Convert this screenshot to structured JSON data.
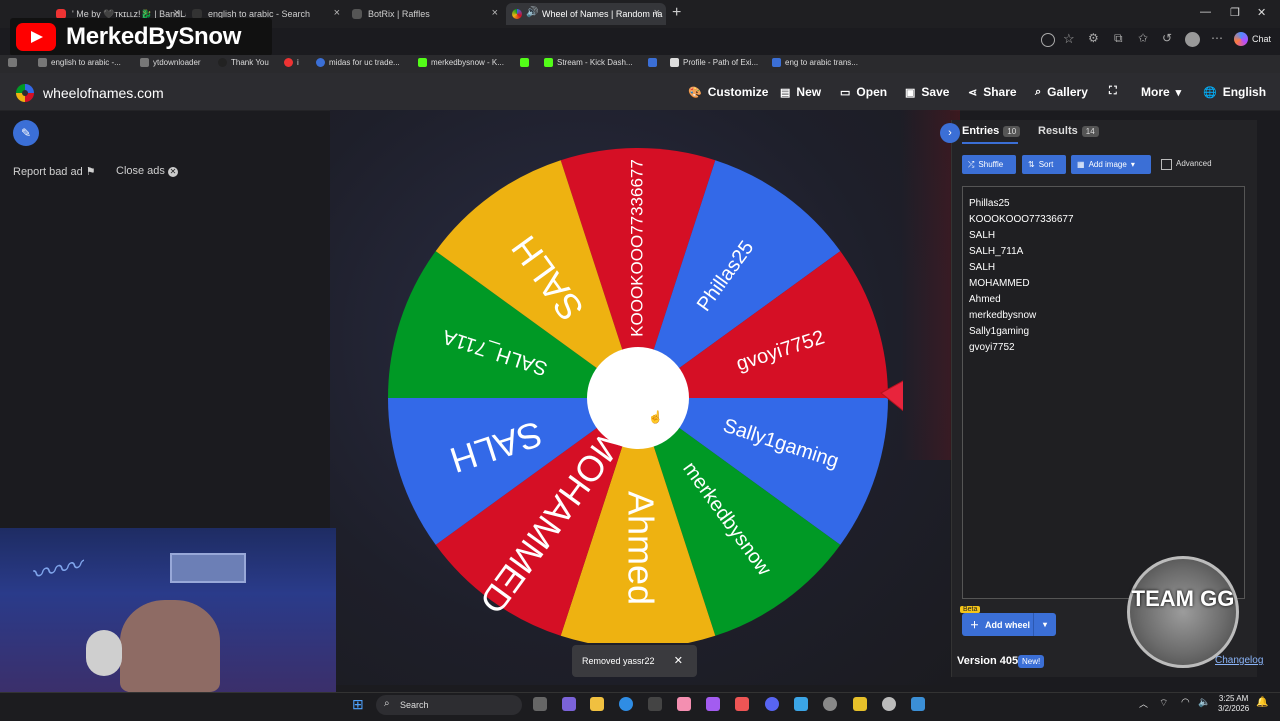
{
  "browser": {
    "tabs": [
      {
        "title": "' Me by 🖤ᴛᴋɪʟʟᴢ!🐉 | BandLab",
        "active": false
      },
      {
        "title": "english to arabic - Search",
        "active": false
      },
      {
        "title": "BotRix | Raffles",
        "active": false
      },
      {
        "title": "Wheel of Names | Random na",
        "active": true
      }
    ],
    "new_tab": "+",
    "bookmarks": [
      "english to arabic -...",
      "ytdownloader",
      "Thank You",
      "i",
      "midas for uc trade...",
      "merkedbysnow - K...",
      "Stream - Kick Dash...",
      "Profile - Path of Exi...",
      "eng to arabic trans..."
    ],
    "chat_label": "Chat"
  },
  "overlay": {
    "channel_name": "MerkedBySnow"
  },
  "site": {
    "title": "wheelofnames.com",
    "nav": [
      "Customize",
      "New",
      "Open",
      "Save",
      "Share",
      "Gallery",
      "More",
      "English"
    ]
  },
  "left": {
    "report_ad": "Report bad ad",
    "close_ads": "Close ads"
  },
  "wheel": {
    "segments": [
      {
        "label": "KOOOKOOO77336677",
        "color": "#d50f25"
      },
      {
        "label": "Phillas25",
        "color": "#3369e8"
      },
      {
        "label": "gvoyi7752",
        "color": "#d50f25"
      },
      {
        "label": "Sally1gaming",
        "color": "#3369e8"
      },
      {
        "label": "merkedbysnow",
        "color": "#009925"
      },
      {
        "label": "Ahmed",
        "color": "#eeb211"
      },
      {
        "label": "MOHAMMED",
        "color": "#d50f25"
      },
      {
        "label": "SALH",
        "color": "#3369e8"
      },
      {
        "label": "SALH_711A",
        "color": "#009925"
      },
      {
        "label": "SALH",
        "color": "#eeb211"
      }
    ]
  },
  "panel": {
    "tab_entries": "Entries",
    "entries_count": "10",
    "tab_results": "Results",
    "results_count": "14",
    "btn_shuffle": "Shuffle",
    "btn_sort": "Sort",
    "btn_add_image": "Add image",
    "advanced_label": "Advanced",
    "entries": [
      "Phillas25",
      "KOOOKOOO77336677",
      "SALH",
      "SALH_711A",
      "SALH",
      "MOHAMMED",
      "Ahmed",
      "merkedbysnow",
      "Sally1gaming",
      "gvoyi7752"
    ],
    "beta_badge": "Beta",
    "add_wheel": "Add wheel",
    "version": "Version 405",
    "new_badge": "New!",
    "changelog": "Changelog"
  },
  "badge": {
    "team_label": "TEAM GG"
  },
  "toast": {
    "message": "Removed yassr22"
  },
  "taskbar": {
    "search_label": "Search",
    "time": "3:25 AM",
    "date": "3/2/2026"
  }
}
